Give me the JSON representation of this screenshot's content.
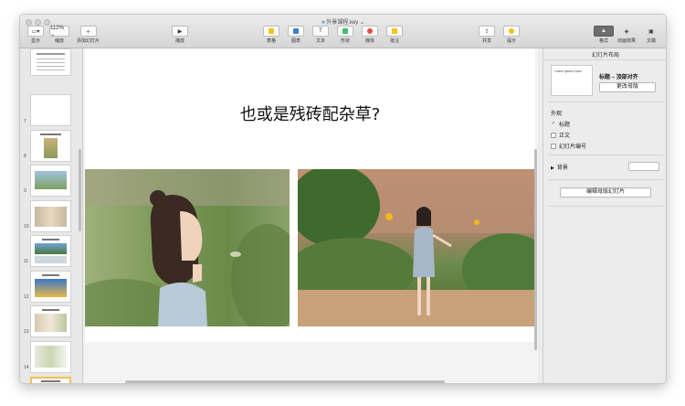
{
  "window": {
    "title": "外景课程.key ⌄"
  },
  "toolbar": {
    "view_label": "显示",
    "zoom_value": "112% ⌄",
    "zoom_label": "缩放",
    "add_slide_label": "添加幻灯片",
    "play_label": "播放",
    "table_label": "表格",
    "chart_label": "图表",
    "text_label": "文本",
    "shape_label": "形状",
    "media_label": "媒体",
    "comment_label": "批注",
    "share_label": "共享",
    "tips_label": "提示",
    "format_label": "格式",
    "animate_label": "动画效果",
    "document_label": "文稿",
    "colors": {
      "table": "#f5c518",
      "chart": "#3a7fd6",
      "shape": "#3dbf6e",
      "media": "#e74c3c",
      "comment": "#f5c518",
      "tips": "#f1c40f"
    }
  },
  "sidebar": {
    "slide_numbers": [
      "7",
      "8",
      "9",
      "10",
      "11",
      "12",
      "13",
      "14"
    ]
  },
  "slide": {
    "title": "也或是残砖配杂草?"
  },
  "right_panel": {
    "header": "幻灯片布局",
    "thumb_text": "Lorem Ipsum Dolor",
    "layout_name": "标题 – 顶部对齐",
    "change_master": "更改母版",
    "appearance": "外观",
    "opt_title": "标题",
    "opt_title_checked": "✓",
    "opt_body": "正文",
    "opt_slide_number": "幻灯片编号",
    "background": "背景",
    "edit_master": "编辑母版幻灯片"
  }
}
